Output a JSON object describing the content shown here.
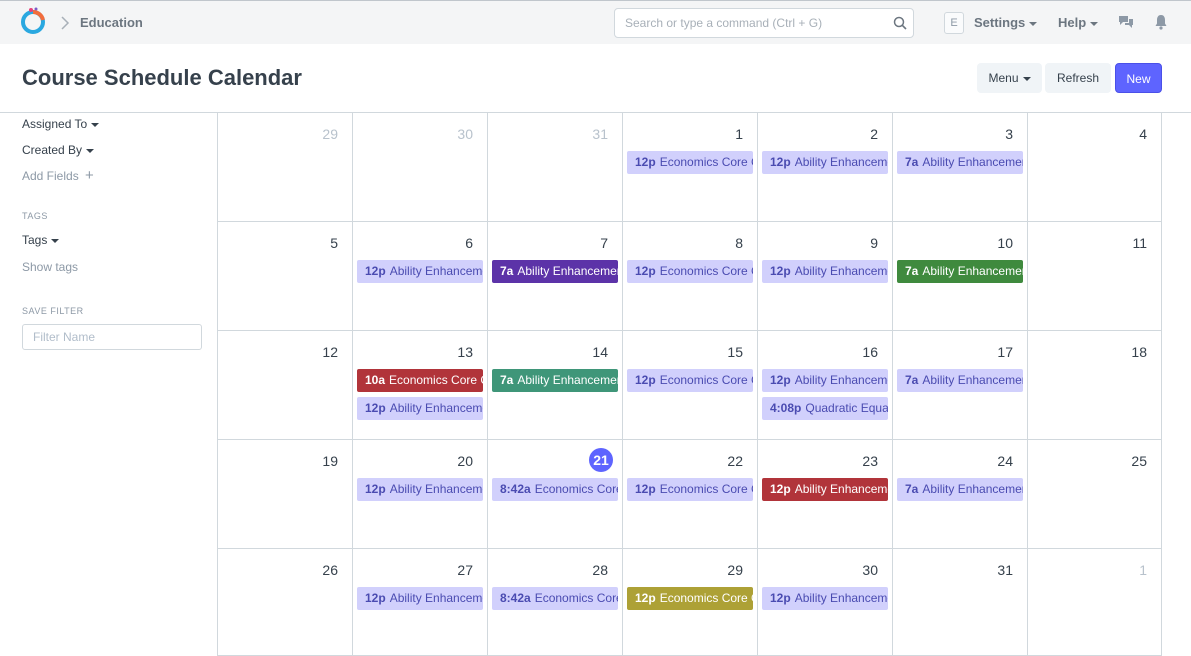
{
  "breadcrumb": {
    "module": "Education"
  },
  "search": {
    "placeholder": "Search or type a command (Ctrl + G)"
  },
  "nav": {
    "avatar_letter": "E",
    "settings_label": "Settings",
    "help_label": "Help"
  },
  "page": {
    "title": "Course Schedule Calendar",
    "menu_label": "Menu",
    "refresh_label": "Refresh",
    "new_label": "New"
  },
  "sidebar": {
    "assigned_to": "Assigned To",
    "created_by": "Created By",
    "add_fields": "Add Fields",
    "tags_heading": "TAGS",
    "tags": "Tags",
    "show_tags": "Show tags",
    "save_filter_heading": "SAVE FILTER",
    "filter_placeholder": "Filter Name"
  },
  "colors": {
    "primary": "#5e64ff",
    "event_default": "#d1d0fc",
    "event_purple": "#5c33a8",
    "event_green": "#3f8a3e",
    "event_red": "#b1343a",
    "event_teal": "#3f9679",
    "event_olive": "#ada136"
  },
  "calendar": {
    "weeks": [
      [
        {
          "day": "29",
          "other": true,
          "events": []
        },
        {
          "day": "30",
          "other": true,
          "events": []
        },
        {
          "day": "31",
          "other": true,
          "events": []
        },
        {
          "day": "1",
          "events": [
            {
              "time": "12p",
              "title": "Economics Core Course",
              "color": "lav"
            }
          ]
        },
        {
          "day": "2",
          "events": [
            {
              "time": "12p",
              "title": "Ability Enhancement",
              "color": "lav"
            }
          ]
        },
        {
          "day": "3",
          "events": [
            {
              "time": "7a",
              "title": "Ability Enhancement",
              "color": "lav"
            }
          ]
        },
        {
          "day": "4",
          "events": []
        }
      ],
      [
        {
          "day": "5",
          "events": []
        },
        {
          "day": "6",
          "events": [
            {
              "time": "12p",
              "title": "Ability Enhancement",
              "color": "lav"
            }
          ]
        },
        {
          "day": "7",
          "events": [
            {
              "time": "7a",
              "title": "Ability Enhancement",
              "color": "purple"
            }
          ]
        },
        {
          "day": "8",
          "events": [
            {
              "time": "12p",
              "title": "Economics Core Course",
              "color": "lav"
            }
          ]
        },
        {
          "day": "9",
          "events": [
            {
              "time": "12p",
              "title": "Ability Enhancement",
              "color": "lav"
            }
          ]
        },
        {
          "day": "10",
          "events": [
            {
              "time": "7a",
              "title": "Ability Enhancement",
              "color": "green"
            }
          ]
        },
        {
          "day": "11",
          "events": []
        }
      ],
      [
        {
          "day": "12",
          "events": []
        },
        {
          "day": "13",
          "events": [
            {
              "time": "10a",
              "title": "Economics Core Course",
              "color": "red"
            },
            {
              "time": "12p",
              "title": "Ability Enhancement",
              "color": "lav"
            }
          ]
        },
        {
          "day": "14",
          "events": [
            {
              "time": "7a",
              "title": "Ability Enhancement",
              "color": "teal"
            }
          ]
        },
        {
          "day": "15",
          "events": [
            {
              "time": "12p",
              "title": "Economics Core Course",
              "color": "lav"
            }
          ]
        },
        {
          "day": "16",
          "events": [
            {
              "time": "12p",
              "title": "Ability Enhancement",
              "color": "lav"
            },
            {
              "time": "4:08p",
              "title": "Quadratic Equations",
              "color": "lav"
            }
          ]
        },
        {
          "day": "17",
          "events": [
            {
              "time": "7a",
              "title": "Ability Enhancement",
              "color": "lav"
            }
          ]
        },
        {
          "day": "18",
          "events": []
        }
      ],
      [
        {
          "day": "19",
          "events": []
        },
        {
          "day": "20",
          "events": [
            {
              "time": "12p",
              "title": "Ability Enhancement",
              "color": "lav"
            }
          ]
        },
        {
          "day": "21",
          "today": true,
          "events": [
            {
              "time": "8:42a",
              "title": "Economics Core Course",
              "color": "lav"
            }
          ]
        },
        {
          "day": "22",
          "events": [
            {
              "time": "12p",
              "title": "Economics Core Course",
              "color": "lav"
            }
          ]
        },
        {
          "day": "23",
          "events": [
            {
              "time": "12p",
              "title": "Ability Enhancement",
              "color": "red"
            }
          ]
        },
        {
          "day": "24",
          "events": [
            {
              "time": "7a",
              "title": "Ability Enhancement",
              "color": "lav"
            }
          ]
        },
        {
          "day": "25",
          "events": []
        }
      ],
      [
        {
          "day": "26",
          "events": []
        },
        {
          "day": "27",
          "events": [
            {
              "time": "12p",
              "title": "Ability Enhancement",
              "color": "lav"
            }
          ]
        },
        {
          "day": "28",
          "events": [
            {
              "time": "8:42a",
              "title": "Economics Core Course",
              "color": "lav"
            }
          ]
        },
        {
          "day": "29",
          "events": [
            {
              "time": "12p",
              "title": "Economics Core Course",
              "color": "olive"
            }
          ]
        },
        {
          "day": "30",
          "events": [
            {
              "time": "12p",
              "title": "Ability Enhancement",
              "color": "lav"
            }
          ]
        },
        {
          "day": "31",
          "events": []
        },
        {
          "day": "1",
          "other": true,
          "events": []
        }
      ]
    ]
  }
}
